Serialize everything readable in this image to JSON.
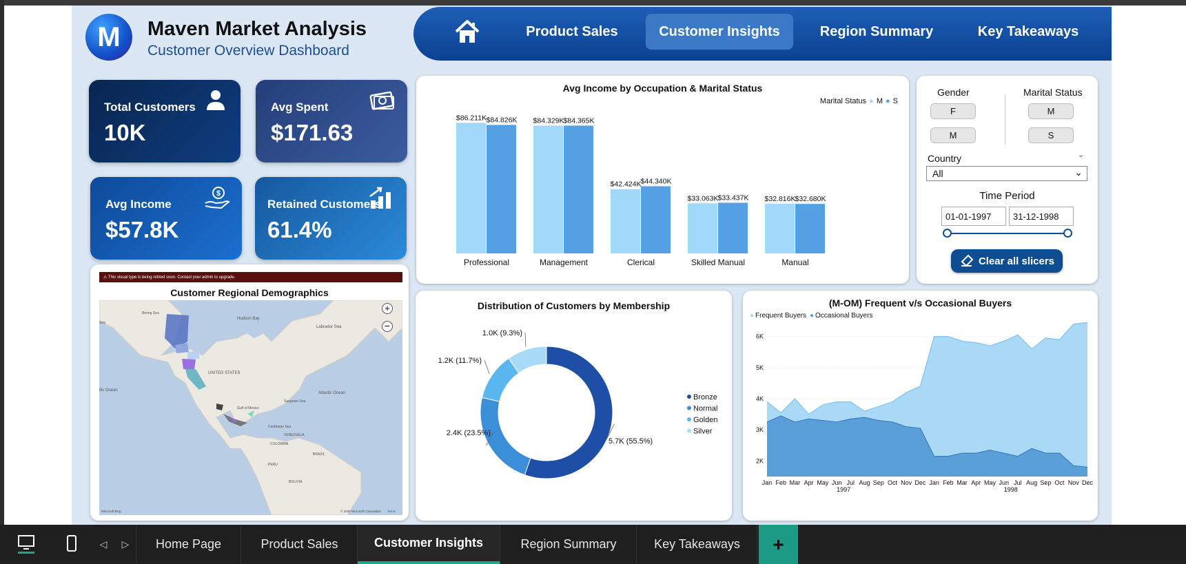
{
  "header": {
    "logo_letter": "M",
    "title": "Maven Market Analysis",
    "subtitle": "Customer Overview Dashboard"
  },
  "nav": {
    "home_icon": "home-icon",
    "items": [
      {
        "label": "Product Sales"
      },
      {
        "label": "Customer Insights",
        "active": true
      },
      {
        "label": "Region Summary"
      },
      {
        "label": "Key Takeaways"
      }
    ]
  },
  "kpis": [
    {
      "label": "Total Customers",
      "value": "10K",
      "icon": "person-icon",
      "color": "#0a2f66"
    },
    {
      "label": "Avg Spent",
      "value": "$171.63",
      "icon": "money-icon",
      "color": "#2f4a86"
    },
    {
      "label": "Avg Income",
      "value": "$57.8K",
      "icon": "hand-dollar-icon",
      "color": "#1a5fb4"
    },
    {
      "label": "Retained Customers",
      "value": "61.4%",
      "icon": "growth-chart-icon",
      "color": "#1f7ac8"
    }
  ],
  "map": {
    "warning": "This visual type is being retired soon. Contact your admin to upgrade.",
    "title": "Customer Regional Demographics",
    "labels": {
      "hudson_bay": "Hudson Bay",
      "labrador_sea": "Labrador Sea",
      "united_states": "UNITED STATES",
      "atlantic_ocean": "Atlantic Ocean",
      "pacific_ocean": "ific Ocean",
      "sargasso_sea": "Sargasso Sea",
      "gulf_mexico": "Gulf of Mexico",
      "caribbean_sea": "Caribbean Sea",
      "venezuela": "VENEZUELA",
      "colombia": "COLOMBIA",
      "brazil": "BRAZIL",
      "peru": "PERU",
      "bolivia": "BOLIVIA",
      "bering": "Bering Sea",
      "sea_left": "Sea"
    },
    "attribution": "© 2020 Microsoft Corporation",
    "terms": "Terms",
    "brand": "Microsoft Bing"
  },
  "bar_chart": {
    "legend_title": "Marital Status",
    "legend_m": "M",
    "legend_s": "S",
    "color_m": "#a2d8f7",
    "color_s": "#55a0e3"
  },
  "slicers": {
    "gender_title": "Gender",
    "gender_options": [
      "F",
      "M"
    ],
    "marital_title": "Marital Status",
    "marital_options": [
      "M",
      "S"
    ],
    "country_title": "Country",
    "country_value": "All",
    "period_title": "Time Period",
    "date_start": "01-01-1997",
    "date_end": "31-12-1998",
    "clear_label": "Clear all slicers"
  },
  "donut": {
    "colors": [
      "#1f4ea6",
      "#3b8ed8",
      "#5ab6ef",
      "#a9dbf8"
    ]
  },
  "area_chart": {
    "color_frequent": "#aad9f6",
    "color_occasional": "#5b9fd9",
    "year1": "1997",
    "year2": "1998"
  },
  "chart_data": [
    {
      "type": "bar",
      "title": "Avg Income by Occupation & Marital Status",
      "categories": [
        "Professional",
        "Management",
        "Clerical",
        "Skilled Manual",
        "Manual"
      ],
      "series": [
        {
          "name": "M",
          "values": [
            86211,
            84329,
            42424,
            33063,
            32816
          ],
          "labels": [
            "$86.211K",
            "$84.329K",
            "$42.424K",
            "$33.063K",
            "$32.816K"
          ]
        },
        {
          "name": "S",
          "values": [
            84826,
            84365,
            44340,
            33437,
            32680
          ],
          "labels": [
            "$84.826K",
            "$84.365K",
            "$44.340K",
            "$33.437K",
            "$32.680K"
          ]
        }
      ],
      "legend": "top-right"
    },
    {
      "type": "pie",
      "title": "Distribution of Customers by Membership",
      "categories": [
        "Bronze",
        "Normal",
        "Golden",
        "Silver"
      ],
      "values": [
        5.7,
        2.4,
        1.2,
        1.0
      ],
      "labels": [
        "5.7K (55.5%)",
        "2.4K (23.5%)",
        "1.2K (11.7%)",
        "1.0K (9.3%)"
      ],
      "legend": "right"
    },
    {
      "type": "area",
      "title": "(M-OM) Frequent v/s Occasional Buyers",
      "x": [
        "Jan",
        "Feb",
        "Mar",
        "Apr",
        "May",
        "Jun",
        "Jul",
        "Aug",
        "Sep",
        "Oct",
        "Nov",
        "Dec",
        "Jan",
        "Feb",
        "Mar",
        "Apr",
        "May",
        "Jun",
        "Jul",
        "Aug",
        "Sep",
        "Oct",
        "Nov",
        "Dec"
      ],
      "series": [
        {
          "name": "Frequent Buyers",
          "values": [
            3900,
            3550,
            4000,
            3500,
            3800,
            3900,
            3900,
            3600,
            3750,
            3900,
            4200,
            4400,
            6000,
            6000,
            5850,
            5800,
            5700,
            5850,
            6050,
            5600,
            5950,
            5900,
            6400,
            6450
          ]
        },
        {
          "name": "Occasional Buyers",
          "values": [
            3250,
            3450,
            3250,
            3350,
            3300,
            3250,
            3350,
            3400,
            3300,
            3250,
            3100,
            3050,
            2150,
            2150,
            2250,
            2250,
            2350,
            2250,
            2150,
            2400,
            2250,
            2250,
            1850,
            1800
          ]
        }
      ],
      "yticks": [
        "2K",
        "3K",
        "4K",
        "5K",
        "6K"
      ],
      "ylim": [
        1500,
        6500
      ],
      "legend": "top-left"
    }
  ],
  "bottombar": {
    "desktop_icon": "desktop-icon",
    "phone_icon": "phone-icon",
    "prev_icon": "prev-icon",
    "next_icon": "next-icon",
    "tabs": [
      "Home Page",
      "Product Sales",
      "Customer Insights",
      "Region Summary",
      "Key Takeaways"
    ],
    "active_tab": "Customer Insights",
    "add_label": "+"
  }
}
